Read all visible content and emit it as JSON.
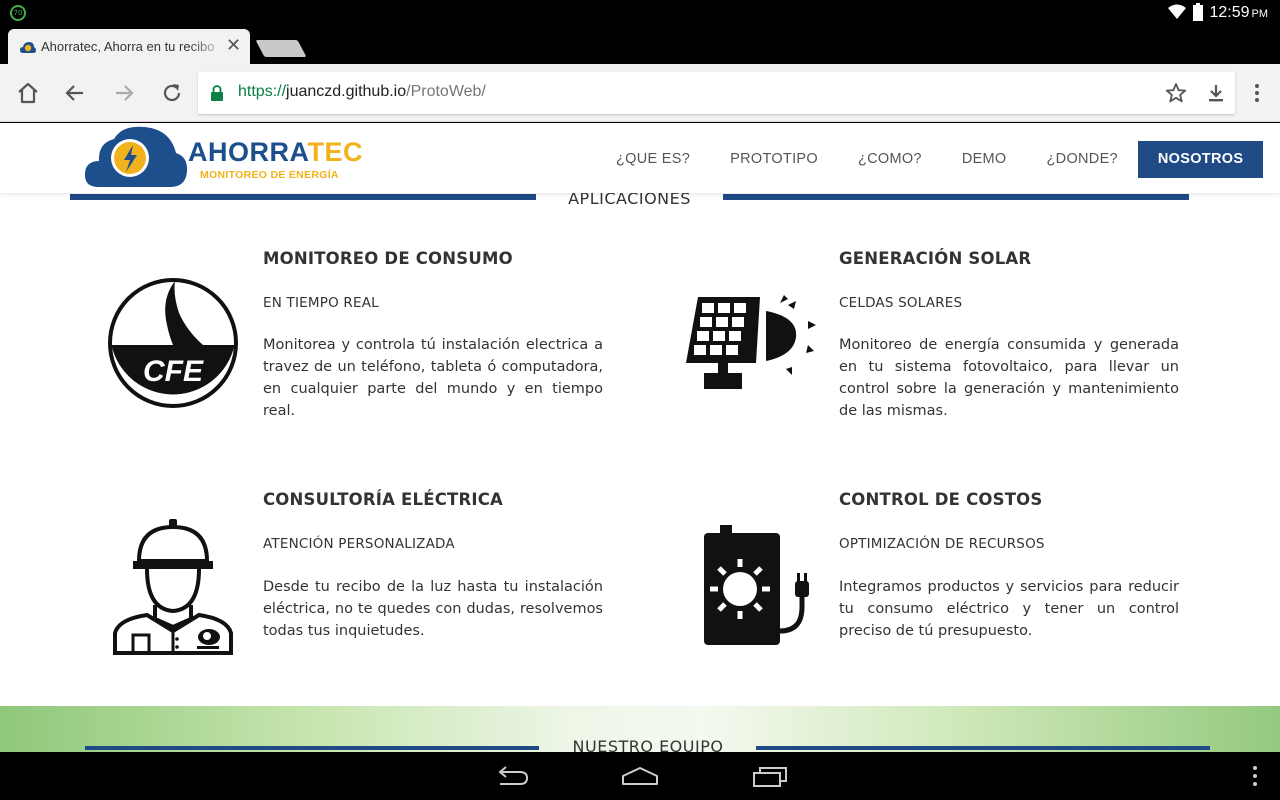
{
  "status_bar": {
    "notification_badge": "70",
    "time": "12:59",
    "ampm": "PM"
  },
  "browser": {
    "tab": {
      "title": "Ahorratec, Ahorra en tu recibo",
      "close_icon": "close-icon"
    },
    "url": {
      "scheme": "https://",
      "host": "juanczd.github.io",
      "path": "/ProtoWeb/"
    }
  },
  "site": {
    "logo": {
      "word_a": "AHORRA",
      "word_b": "TEC",
      "subtitle": "MONITOREO DE ENERGÍA"
    },
    "nav": [
      {
        "label": "¿QUE ES?"
      },
      {
        "label": "PROTOTIPO"
      },
      {
        "label": "¿COMO?"
      },
      {
        "label": "DEMO"
      },
      {
        "label": "¿DONDE?"
      },
      {
        "label": "NOSOTROS",
        "active": true
      }
    ],
    "section_title": "APLICACIONES",
    "features": [
      {
        "title": "MONITOREO DE CONSUMO",
        "subtitle": "EN TIEMPO REAL",
        "body": "Monitorea y controla tú instalación electrica a travez de un teléfono, tableta ó computadora, en cualquier parte del mundo y en tiempo real.",
        "icon": "cfe-meter-icon",
        "icon_text": "CFE"
      },
      {
        "title": "GENERACIÓN SOLAR",
        "subtitle": "CELDAS SOLARES",
        "body": "Monitoreo de energía consumida y generada en tu sistema fotovoltaico, para llevar un control sobre la generación y mantenimiento de las mismas.",
        "icon": "solar-panel-icon"
      },
      {
        "title": "CONSULTORÍA ELÉCTRICA",
        "subtitle": "ATENCIÓN PERSONALIZADA",
        "body": "Desde tu recibo de la luz hasta tu instalación eléctrica, no te quedes con dudas, resolvemos todas tus inquietudes.",
        "icon": "electrician-icon"
      },
      {
        "title": "CONTROL DE COSTOS",
        "subtitle": "OPTIMIZACIÓN DE RECURSOS",
        "body": "Integramos productos y servicios para reducir tu consumo eléctrico y tener un control preciso de tú presupuesto.",
        "icon": "solar-battery-icon"
      }
    ],
    "team_title": "NUESTRO EQUIPO"
  },
  "colors": {
    "brand_blue": "#1f4a86",
    "brand_yellow": "#f2b21b",
    "secure_green": "#0b8043"
  }
}
